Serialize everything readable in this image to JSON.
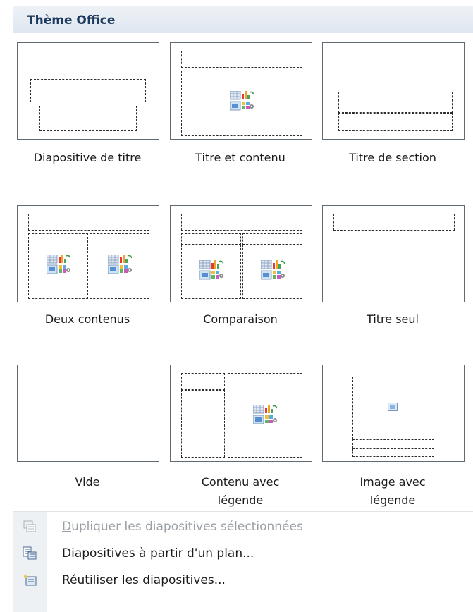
{
  "header": {
    "title": "Thème Office"
  },
  "layouts": [
    {
      "label": "Diapositive de titre"
    },
    {
      "label": "Titre et contenu"
    },
    {
      "label": "Titre de section"
    },
    {
      "label": "Deux contenus"
    },
    {
      "label": "Comparaison"
    },
    {
      "label": "Titre seul"
    },
    {
      "label": "Vide"
    },
    {
      "label_line1": "Contenu avec",
      "label_line2": "légende"
    },
    {
      "label_line1": "Image avec",
      "label_line2": "légende"
    }
  ],
  "menu": [
    {
      "key_letter": "D",
      "label_rest": "upliquer les diapositives sélectionnées",
      "icon": "duplicate-slides-icon",
      "enabled": false
    },
    {
      "label_pre": "Diap",
      "key_letter": "o",
      "label_rest": "sitives à partir d'un plan...",
      "icon": "slides-from-outline-icon",
      "enabled": true
    },
    {
      "key_letter": "R",
      "label_rest": "éutiliser les diapositives...",
      "icon": "reuse-slides-icon",
      "enabled": true
    }
  ]
}
